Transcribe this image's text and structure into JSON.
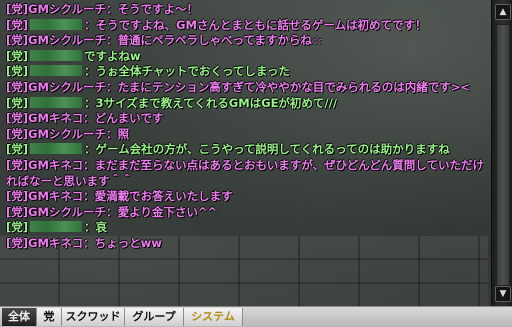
{
  "messages": [
    {
      "prefix": "[党]GMシクルーチ：",
      "text": "そうですよ～！",
      "color": "pink",
      "redacted": false
    },
    {
      "prefix": "[党]",
      "text": "：そうですよね、GMさんとまともに話せるゲームは初めてです！",
      "color": "pink",
      "redacted": true
    },
    {
      "prefix": "[党]GMシクルーチ：",
      "text": "普通にペラペラしゃべってますからね☆",
      "color": "pink",
      "redacted": false
    },
    {
      "prefix": "[党]",
      "text": "ですよねw",
      "color": "green",
      "redacted": true
    },
    {
      "prefix": "[党]",
      "text": "：うぉ全体チャットでおくってしまった",
      "color": "green",
      "redacted": true
    },
    {
      "prefix": "[党]GMシクルーチ：",
      "text": "たまにテンション高すぎて冷ややかな目でみられるのは内緒です><",
      "color": "pink",
      "redacted": false,
      "wrap": true
    },
    {
      "prefix": "[党]",
      "text": "：3サイズまで教えてくれるGMはGEが初めて///",
      "color": "green",
      "redacted": true
    },
    {
      "prefix": "[党]GMキネコ：",
      "text": "どんまいです",
      "color": "pink",
      "redacted": false
    },
    {
      "prefix": "[党]GMシクルーチ：",
      "text": "照",
      "color": "pink",
      "redacted": false
    },
    {
      "prefix": "[党]",
      "text": "：ゲーム会社の方が、こうやって説明してくれるってのは助かりますね",
      "color": "green",
      "redacted": true
    },
    {
      "prefix": "[党]GMキネコ：",
      "text": "まだまだ至らない点はあるとおもいますが、ぜひどんどん質問していただければなーと思います＾＾",
      "color": "pink",
      "redacted": false,
      "wrap": true
    },
    {
      "prefix": "[党]GMキネコ：",
      "text": "愛満載でお答えいたします",
      "color": "pink",
      "redacted": false
    },
    {
      "prefix": "[党]GMシクルーチ：",
      "text": "愛より金下さい^^",
      "color": "pink",
      "redacted": false
    },
    {
      "prefix": "[党]",
      "text": "：哀",
      "color": "green",
      "redacted": true
    },
    {
      "prefix": "[党]GMキネコ：",
      "text": "ちょっとww",
      "color": "pink",
      "redacted": false
    }
  ],
  "tabs": {
    "all": "全体",
    "party": "党",
    "squad": "スクワッド",
    "group": "グループ",
    "system": "システム"
  },
  "scrollbar": {
    "up_icon": "▲",
    "down_icon": "▼"
  },
  "colors": {
    "pink": "#f07ef0",
    "green": "#9af58a",
    "system_tab": "#b08a10"
  }
}
